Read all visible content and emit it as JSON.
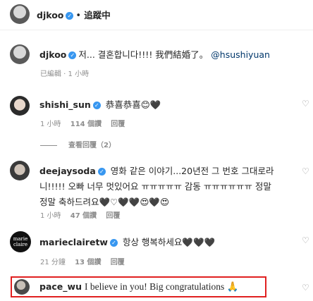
{
  "header": {
    "username": "djkoo",
    "separator": "•",
    "follow_label": "追蹤中"
  },
  "caption": {
    "username": "djkoo",
    "text": "저... 결혼합니다!!!! 我們結婚了。",
    "mention": "@hsushiyuan",
    "edited": "已編輯",
    "time": "1 小時"
  },
  "comments": [
    {
      "username": "shishi_sun",
      "text": "恭喜恭喜😊🖤",
      "time": "1 小時",
      "likes": "114 個讚",
      "reply": "回覆",
      "view_replies": "查看回覆（2）"
    },
    {
      "username": "deejaysoda",
      "text_line1": "영화 같은 이야기...20년전 그 번호 그대로라",
      "text_line2": "니!!!!! 오빠 너무 멋있어요 ㅠㅠㅠㅠㅠ 감동 ㅠㅠㅠㅠㅠㅠ 정말",
      "text_line3": "정말 축하드려요🖤♡🖤🖤😍🖤😍",
      "time": "1 小時",
      "likes": "47 個讚",
      "reply": "回覆"
    },
    {
      "username": "marieclairetw",
      "text": "항상 행복하세요🖤🖤🖤",
      "time": "21 分鐘",
      "likes": "13 個讚",
      "reply": "回覆",
      "avatar_text": "marie claire"
    },
    {
      "username": "pace_wu",
      "text": "I believe in you! Big congratulations 🙏"
    }
  ],
  "icons": {
    "verified": "✓",
    "heart": "♡"
  },
  "colors": {
    "verified_blue": "#3897f0",
    "highlight_red": "#e02020",
    "meta_grey": "#8e8e8e"
  }
}
